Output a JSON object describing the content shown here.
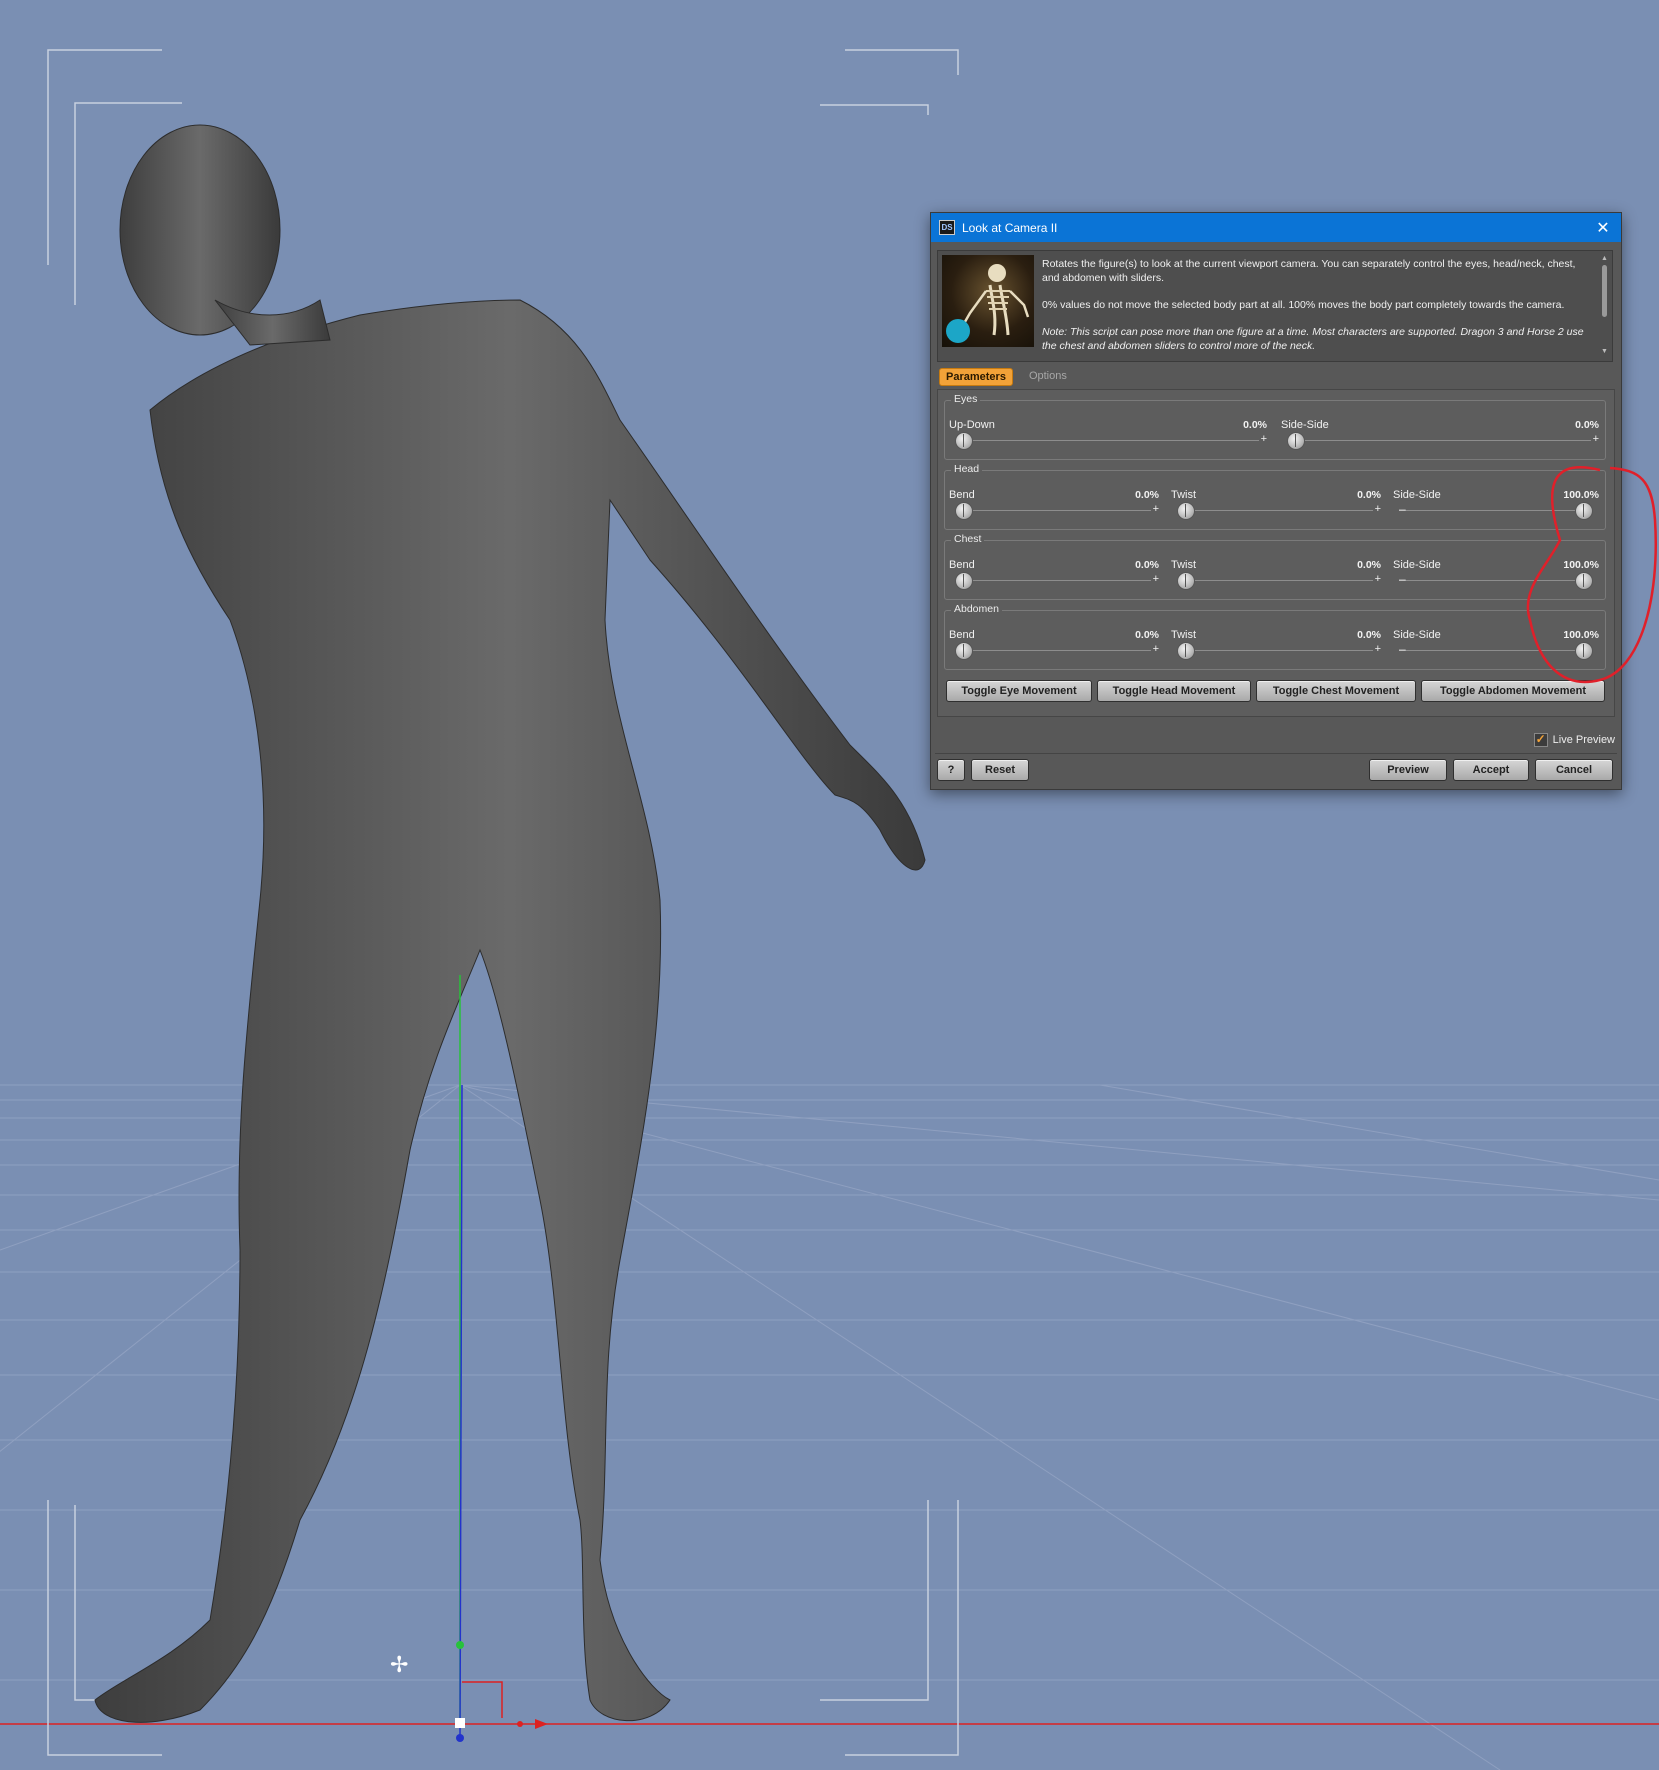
{
  "dialog": {
    "title": "Look at Camera II",
    "app_icon": "DS",
    "description": [
      "Rotates the figure(s) to look at the current viewport camera.  You can separately control the eyes, head/neck, chest, and abdomen with sliders.",
      "0% values do not move the selected body part at all.  100% moves the body part completely towards the camera.",
      "Note: This script can pose more than one figure at a time. Most characters are supported. Dragon 3 and Horse 2 use the chest and abdomen sliders to control more of the neck."
    ],
    "tabs": [
      "Parameters",
      "Options"
    ],
    "groups": [
      {
        "label": "Eyes",
        "sliders": [
          {
            "name": "Up-Down",
            "value": "0.0%",
            "fraction": 0.0
          },
          {
            "name": "Side-Side",
            "value": "0.0%",
            "fraction": 0.0
          }
        ]
      },
      {
        "label": "Head",
        "sliders": [
          {
            "name": "Bend",
            "value": "0.0%",
            "fraction": 0.0
          },
          {
            "name": "Twist",
            "value": "0.0%",
            "fraction": 0.0
          },
          {
            "name": "Side-Side",
            "value": "100.0%",
            "fraction": 1.0
          }
        ]
      },
      {
        "label": "Chest",
        "sliders": [
          {
            "name": "Bend",
            "value": "0.0%",
            "fraction": 0.0
          },
          {
            "name": "Twist",
            "value": "0.0%",
            "fraction": 0.0
          },
          {
            "name": "Side-Side",
            "value": "100.0%",
            "fraction": 1.0
          }
        ]
      },
      {
        "label": "Abdomen",
        "sliders": [
          {
            "name": "Bend",
            "value": "0.0%",
            "fraction": 0.0
          },
          {
            "name": "Twist",
            "value": "0.0%",
            "fraction": 0.0
          },
          {
            "name": "Side-Side",
            "value": "100.0%",
            "fraction": 1.0
          }
        ]
      }
    ],
    "toggles": {
      "eye": "Toggle Eye Movement",
      "head": "Toggle Head Movement",
      "chest": "Toggle Chest Movement",
      "abdomen": "Toggle Abdomen Movement"
    },
    "live_preview": {
      "label": "Live Preview",
      "checked": true
    },
    "buttons": {
      "help": "?",
      "reset": "Reset",
      "preview": "Preview",
      "accept": "Accept",
      "cancel": "Cancel"
    }
  },
  "colors": {
    "viewport_bg": "#7a8fb3",
    "title_bar": "#0b74d6",
    "active_tab": "#f2a238",
    "annotation": "#e0202a"
  }
}
